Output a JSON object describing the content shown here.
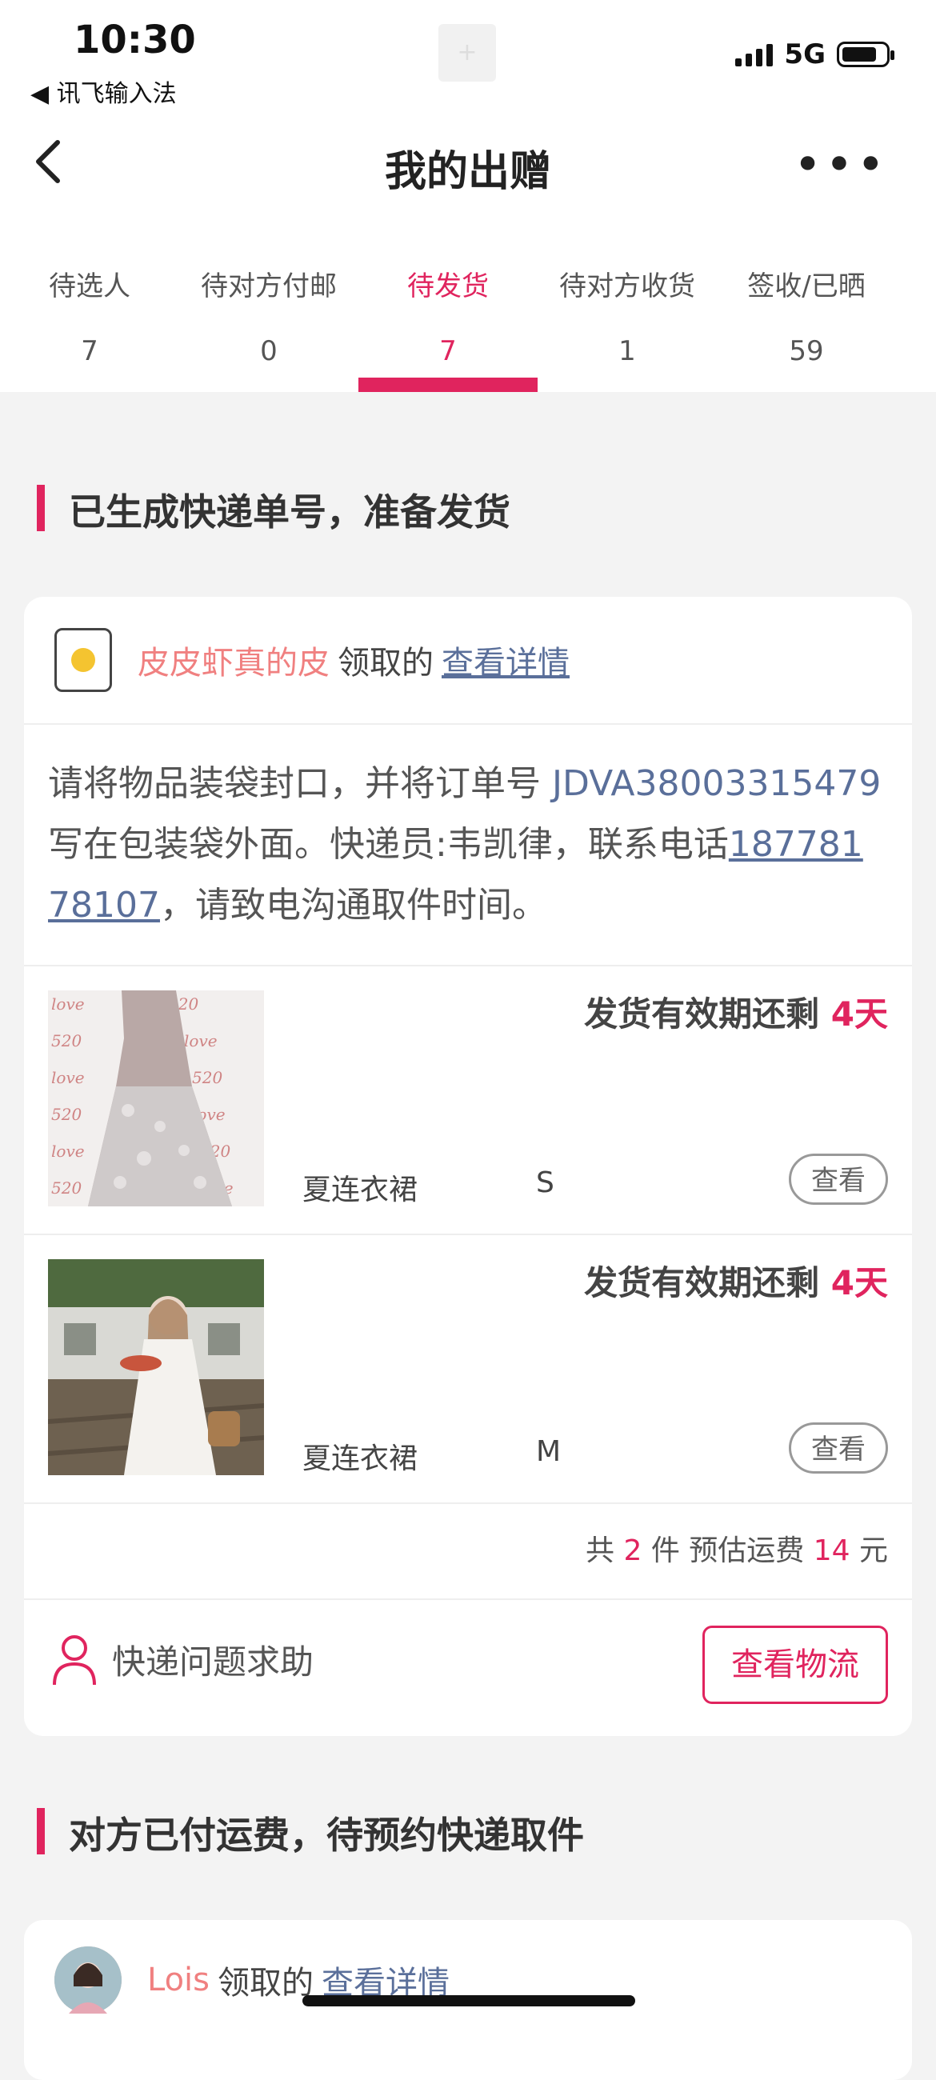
{
  "status_bar": {
    "time": "10:30",
    "back_app": "◀ 讯飞输入法",
    "center_icon": "plus-icon",
    "network": "5G"
  },
  "header": {
    "title": "我的出赠",
    "back_icon": "chevron-left-icon",
    "more_icon": "more-icon",
    "more_glyph": "•••"
  },
  "tabs": [
    {
      "label": "待选人",
      "count": "7",
      "active": false
    },
    {
      "label": "待对方付邮",
      "count": "0",
      "active": false
    },
    {
      "label": "待发货",
      "count": "7",
      "active": true
    },
    {
      "label": "待对方收货",
      "count": "1",
      "active": false
    },
    {
      "label": "签收/已晒",
      "count": "59",
      "active": false
    }
  ],
  "colors": {
    "accent": "#e0245e",
    "link": "#5a6f9a",
    "username": "#f08080"
  },
  "section1": {
    "title": "已生成快递单号，准备发货",
    "card": {
      "user_name": "皮皮虾真的皮",
      "user_action": "领取的",
      "user_link": "查看详情",
      "notice_prefix": "请将物品装袋封口，并将订单号 ",
      "order_no": "JDVA38003315479",
      "notice_mid": " 写在包装袋外面。快递员:韦凯律，联系电话",
      "phone": "18778178107",
      "notice_suffix": "，请致电沟通取件时间。",
      "items": [
        {
          "deadline_prefix": "发货有效期还剩 ",
          "days": "4天",
          "name": "夏连衣裙",
          "size": "S",
          "view": "查看"
        },
        {
          "deadline_prefix": "发货有效期还剩 ",
          "days": "4天",
          "name": "夏连衣裙",
          "size": "M",
          "view": "查看"
        }
      ],
      "summary": {
        "prefix": "共 ",
        "count": "2",
        "mid": " 件 预估运费 ",
        "fee": "14",
        "suffix": " 元"
      },
      "help_text": "快递问题求助",
      "logistics_button": "查看物流"
    }
  },
  "section2": {
    "title": "对方已付运费，待预约快递取件",
    "card": {
      "user_name": "Lois",
      "user_action": "领取的",
      "user_link": "查看详情"
    }
  }
}
